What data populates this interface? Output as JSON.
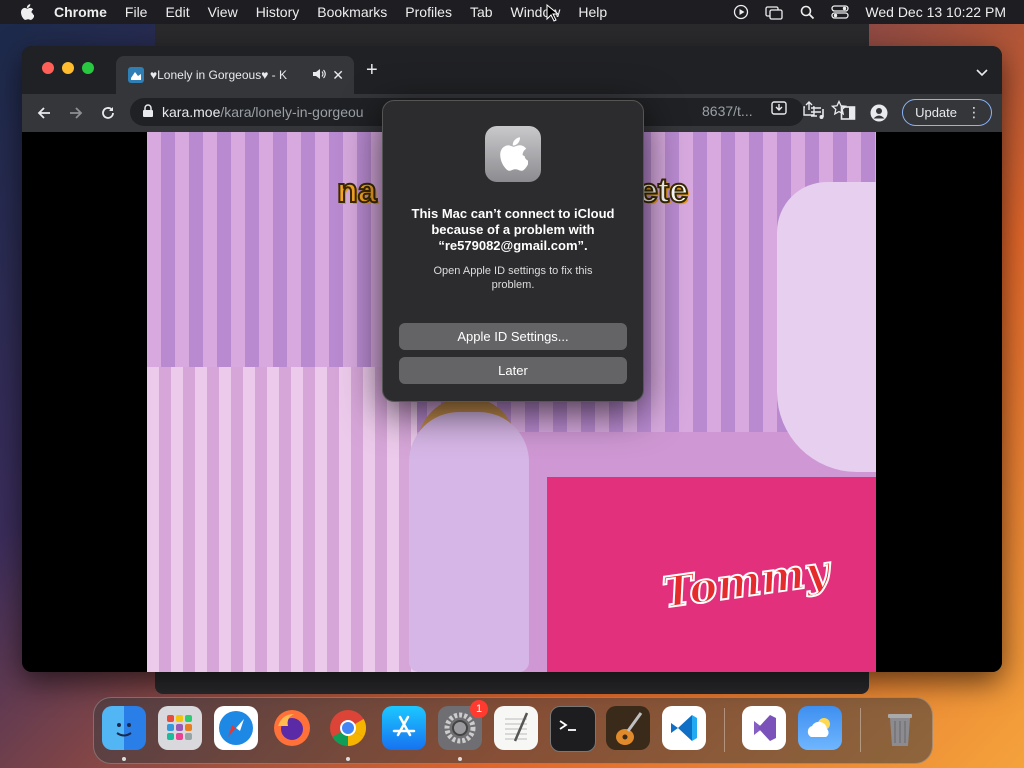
{
  "menubar": {
    "items": [
      "Chrome",
      "File",
      "Edit",
      "View",
      "History",
      "Bookmarks",
      "Profiles",
      "Tab",
      "Window",
      "Help"
    ],
    "clock": "Wed Dec 13  10:22 PM",
    "icons": [
      "play-circle-icon",
      "screen-mirror-icon",
      "spotlight-search-icon",
      "control-center-icon"
    ]
  },
  "browser": {
    "tab_title": "♥Lonely in Gorgeous♥ - K",
    "url_host": "kara.moe",
    "url_path": "/kara/lonely-in-gorgeou",
    "url_tail": "8637/t...",
    "update_label": "Update"
  },
  "video": {
    "caption_left": "na",
    "caption_right": "ete",
    "logo_text": "Tommy"
  },
  "dialog": {
    "message": "This Mac can’t connect to iCloud because of a problem with “re579082@gmail.com”.",
    "info": "Open Apple ID settings to fix this problem.",
    "primary_button": "Apple ID Settings...",
    "secondary_button": "Later"
  },
  "dock": {
    "apps": [
      "Finder",
      "Launchpad",
      "Safari",
      "Firefox",
      "Google Chrome",
      "App Store",
      "System Settings",
      "TextEdit",
      "Terminal",
      "GarageBand",
      "Visual Studio Code",
      "Visual Studio",
      "Weather",
      "Trash"
    ],
    "settings_badge": "1"
  },
  "colors": {
    "accent_blue": "#8ab4f8",
    "dialog_bg": "#2c2c2e",
    "traffic_red": "#ff5f57",
    "traffic_yellow": "#febc2e",
    "traffic_green": "#28c840"
  }
}
